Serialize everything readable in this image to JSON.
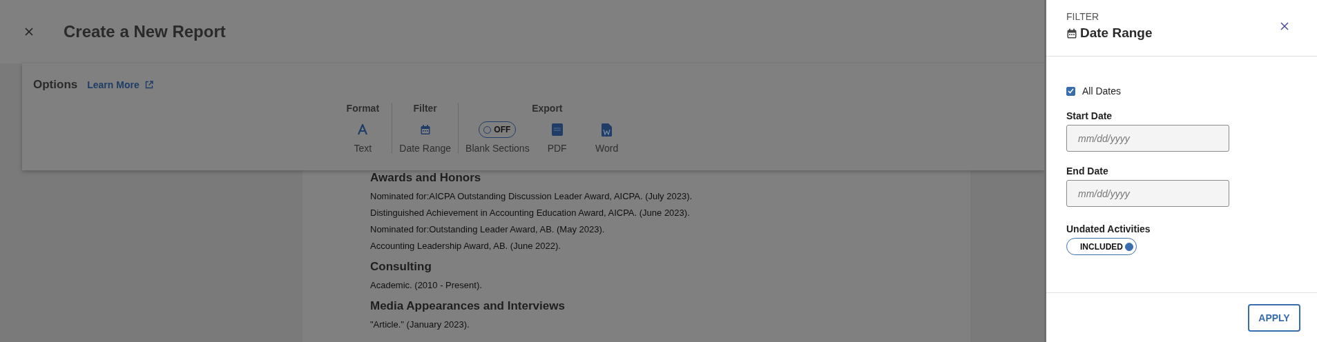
{
  "header": {
    "title": "Create a New Report"
  },
  "options": {
    "title": "Options",
    "learn_more": "Learn More",
    "groups": [
      {
        "label": "Format",
        "items": [
          {
            "kind": "format",
            "label": "Text"
          }
        ]
      },
      {
        "label": "Filter",
        "items": [
          {
            "kind": "calendar",
            "label": "Date Range"
          }
        ]
      },
      {
        "label": "Export",
        "items": [
          {
            "kind": "toggle",
            "on": false,
            "state": "OFF",
            "label": "Blank Sections"
          },
          {
            "kind": "pdf",
            "label": "PDF"
          },
          {
            "kind": "word",
            "label": "Word"
          }
        ]
      }
    ]
  },
  "document": {
    "sections": [
      {
        "heading": "Awards and Honors",
        "entries": [
          "Nominated for:AICPA Outstanding Discussion Leader Award, AICPA. (July 2023).",
          "Distinguished Achievement in Accounting Education Award, AICPA. (June 2023).",
          "Nominated for:Outstanding Leader Award, AB. (May 2023).",
          "Accounting Leadership Award, AB. (June 2022)."
        ]
      },
      {
        "heading": "Consulting",
        "entries": [
          "Academic. (2010 - Present)."
        ]
      },
      {
        "heading": "Media Appearances and Interviews",
        "entries": [
          "\"Article.\" (January 2023)."
        ]
      }
    ]
  },
  "filter_panel": {
    "eyebrow": "FILTER",
    "title": "Date Range",
    "all_dates": {
      "label": "All Dates",
      "checked": true
    },
    "fields": [
      {
        "label": "Start Date",
        "placeholder": "mm/dd/yyyy"
      },
      {
        "label": "End Date",
        "placeholder": "mm/dd/yyyy"
      }
    ],
    "undated": {
      "label": "Undated Activities",
      "state": "INCLUDED",
      "on": true
    },
    "apply": "APPLY"
  }
}
